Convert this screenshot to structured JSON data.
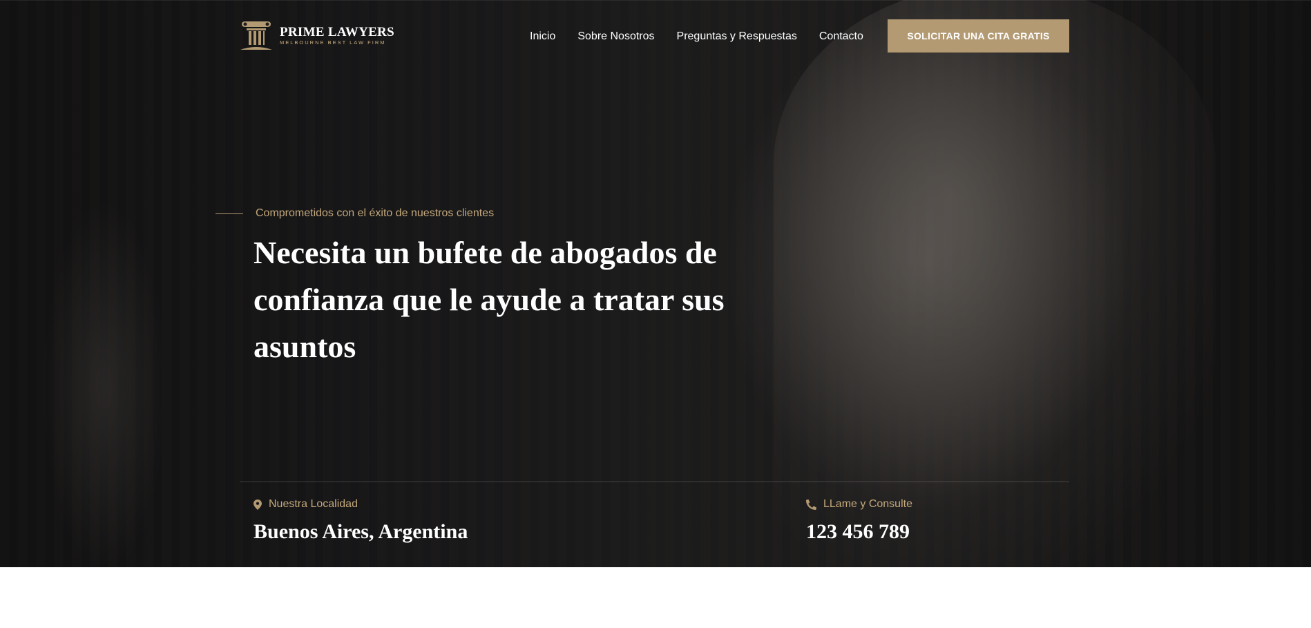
{
  "brand": {
    "name": "PRIME LAWYERS",
    "tagline": "MELBOURNE BEST LAW FIRM"
  },
  "nav": {
    "items": [
      "Inicio",
      "Sobre Nosotros",
      "Preguntas y Respuestas",
      "Contacto"
    ],
    "cta_label": "SOLICITAR UNA CITA GRATIS"
  },
  "hero": {
    "eyebrow": "Comprometidos con el éxito de nuestros clientes",
    "headline": "Necesita un bufete de abogados de confianza que le ayude a tratar sus asuntos"
  },
  "info": {
    "location": {
      "label": "Nuestra Localidad",
      "value": "Buenos Aires, Argentina",
      "icon": "map-pin-icon"
    },
    "phone": {
      "label": "LLame y Consulte",
      "value": "123 456 789",
      "icon": "phone-icon"
    }
  },
  "colors": {
    "accent": "#b39a73",
    "accent_text": "#c3a87c",
    "hero_bg": "#1e1e1f",
    "text": "#ffffff"
  }
}
